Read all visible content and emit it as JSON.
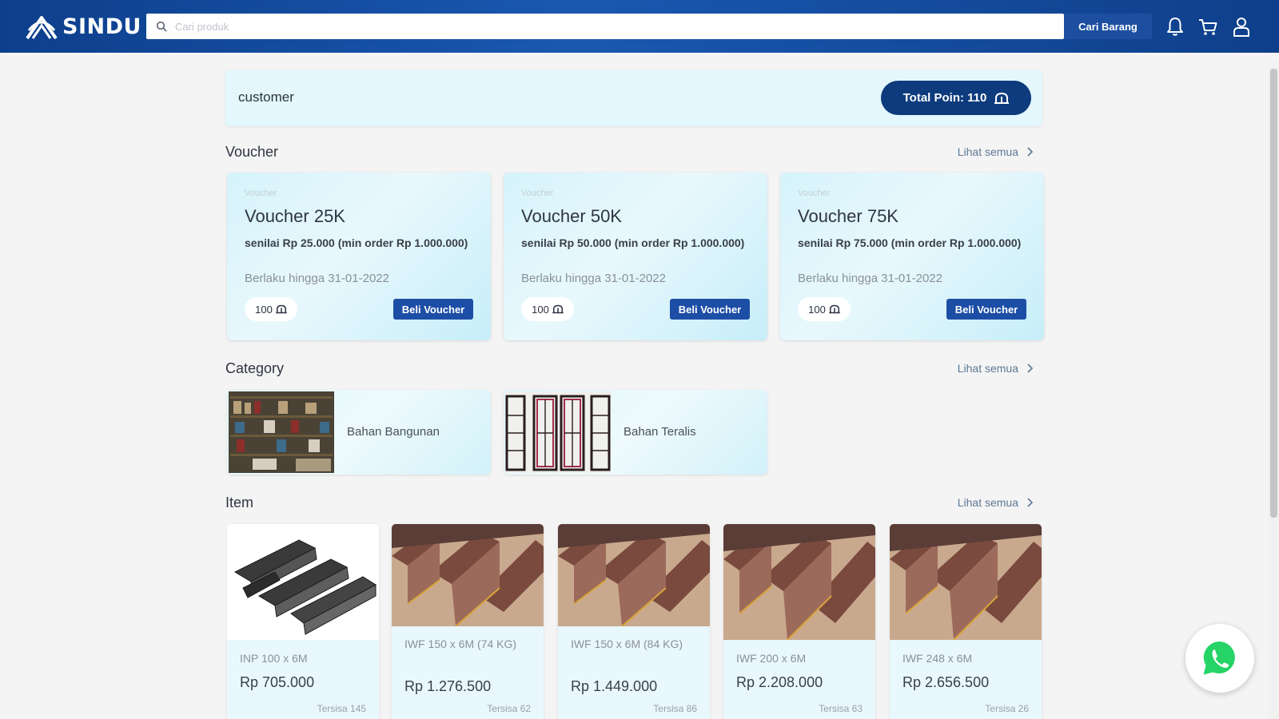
{
  "header": {
    "logo_text": "SINDU",
    "search_placeholder": "Cari produk",
    "search_button": "Cari Barang",
    "icons": [
      "bell-icon",
      "cart-icon",
      "user-icon"
    ]
  },
  "customer": {
    "name": "customer",
    "points_label": "Total Poin: 110"
  },
  "vouchers": {
    "title": "Voucher",
    "see_all": "Lihat semua",
    "items": [
      {
        "kicker": "Voucher",
        "name": "Voucher 25K",
        "desc": "senilai Rp 25.000 (min order Rp 1.000.000)",
        "valid": "Berlaku hingga 31-01-2022",
        "points": "100",
        "button": "Beli Voucher"
      },
      {
        "kicker": "Voucher",
        "name": "Voucher 50K",
        "desc": "senilai Rp 50.000 (min order Rp 1.000.000)",
        "valid": "Berlaku hingga 31-01-2022",
        "points": "100",
        "button": "Beli Voucher"
      },
      {
        "kicker": "Voucher",
        "name": "Voucher 75K",
        "desc": "senilai Rp 75.000 (min order Rp 1.000.000)",
        "valid": "Berlaku hingga 31-01-2022",
        "points": "100",
        "button": "Beli Voucher"
      }
    ]
  },
  "categories": {
    "title": "Category",
    "see_all": "Lihat semua",
    "items": [
      {
        "label": "Bahan Bangunan"
      },
      {
        "label": "Bahan Teralis"
      }
    ]
  },
  "products": {
    "title": "Item",
    "see_all": "Lihat semua",
    "items": [
      {
        "name": "INP 100 x 6M",
        "price": "Rp 705.000",
        "stock": "Tersisa 145"
      },
      {
        "name": "IWF 150 x 6M (74 KG)",
        "price": "Rp 1.276.500",
        "stock": "Tersisa 62"
      },
      {
        "name": "IWF 150 x 6M (84 KG)",
        "price": "Rp 1.449.000",
        "stock": "Tersisa 86"
      },
      {
        "name": "IWF 200 x 6M",
        "price": "Rp 2.208.000",
        "stock": "Tersisa 63"
      },
      {
        "name": "IWF 248 x 6M",
        "price": "Rp 2.656.500",
        "stock": "Tersisa 26"
      }
    ]
  },
  "colors": {
    "header": "#1a58b0",
    "primary_button": "#1d4ea6",
    "points_pill": "#0d3b7d",
    "card_bg": "#e3f7fc",
    "whatsapp": "#25d366"
  }
}
